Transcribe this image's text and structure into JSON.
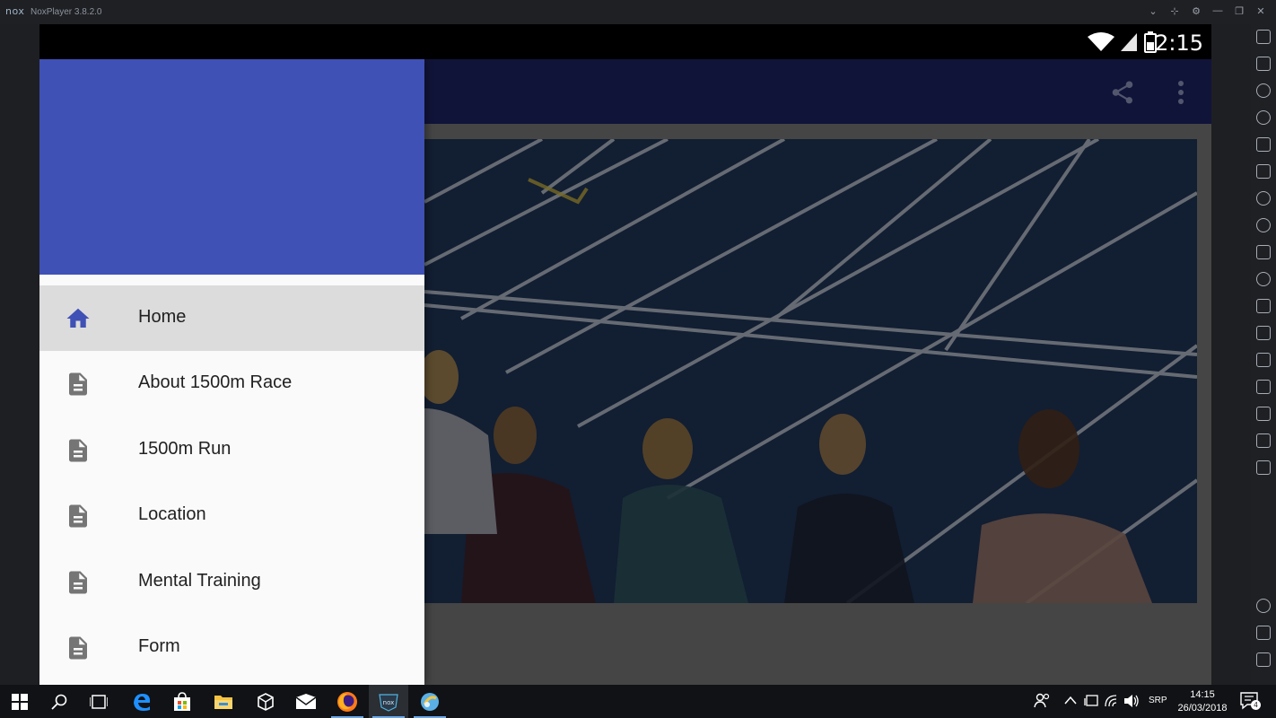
{
  "window": {
    "logo": "nox",
    "title": "NoxPlayer 3.8.2.0",
    "controls": [
      "chevron-down-icon",
      "pin-icon",
      "gear-icon",
      "minimize-icon",
      "restore-icon",
      "close-icon"
    ]
  },
  "status_bar": {
    "time": "2:15",
    "icons": [
      "wifi-icon",
      "signal-icon",
      "battery-icon"
    ]
  },
  "app_bar": {
    "actions": [
      "share-icon",
      "more-vert-icon"
    ]
  },
  "drawer": {
    "header_color": "#3f51b5",
    "items": [
      {
        "label": "Home",
        "icon": "home-icon",
        "active": true
      },
      {
        "label": "About 1500m Race",
        "icon": "document-icon",
        "active": false
      },
      {
        "label": "1500m Run",
        "icon": "document-icon",
        "active": false
      },
      {
        "label": "Location",
        "icon": "document-icon",
        "active": false
      },
      {
        "label": "Mental Training",
        "icon": "document-icon",
        "active": false
      },
      {
        "label": "Form",
        "icon": "document-icon",
        "active": false
      }
    ]
  },
  "content": {
    "image": "runners-on-track-photo"
  },
  "taskbar": {
    "apps": [
      "windows-start-icon",
      "search-icon",
      "task-view-icon",
      "edge-icon",
      "store-icon",
      "file-explorer-icon",
      "unity-icon",
      "mail-icon",
      "firefox-icon",
      "nox-icon",
      "app-icon"
    ],
    "tray": {
      "language": "SRP",
      "time": "14:15",
      "date": "26/03/2018",
      "notifications": "4"
    }
  },
  "colors": {
    "primary": "#3f51b5",
    "app_bar_dimmed": "#1b2058",
    "active_item": "#dcdcdc"
  }
}
